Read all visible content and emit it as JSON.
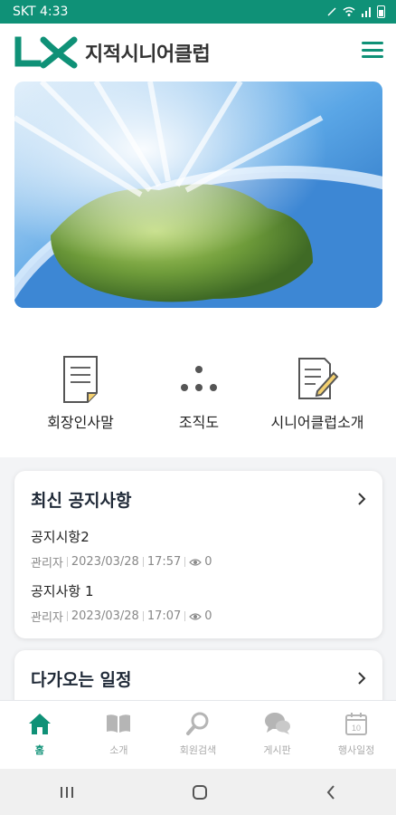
{
  "status_bar": {
    "carrier": "SKT",
    "time": "4:33"
  },
  "header": {
    "app_title": "지적시니어클럽",
    "logo_mark": "LX"
  },
  "hero": {
    "alt": "earth-illustration"
  },
  "quick_menu": [
    {
      "label": "회장인사말",
      "icon": "document-icon"
    },
    {
      "label": "조직도",
      "icon": "org-chart-icon"
    },
    {
      "label": "시니어클럽소개",
      "icon": "edit-document-icon"
    }
  ],
  "notice_card": {
    "title": "최신 공지사항",
    "items": [
      {
        "title": "공지시항2",
        "author": "관리자",
        "date": "2023/03/28",
        "time": "17:57",
        "views": "0"
      },
      {
        "title": "공지사항 1",
        "author": "관리자",
        "date": "2023/03/28",
        "time": "17:07",
        "views": "0"
      }
    ]
  },
  "schedule_card": {
    "title": "다가오는 일정"
  },
  "bottom_nav": [
    {
      "label": "홈",
      "icon": "home-icon",
      "active": true
    },
    {
      "label": "소개",
      "icon": "book-icon",
      "active": false
    },
    {
      "label": "회원검색",
      "icon": "search-icon",
      "active": false
    },
    {
      "label": "게시판",
      "icon": "chat-icon",
      "active": false
    },
    {
      "label": "행사일정",
      "icon": "calendar-icon",
      "active": false
    }
  ],
  "colors": {
    "accent": "#0f9177",
    "inactive": "#aaaaaa"
  }
}
